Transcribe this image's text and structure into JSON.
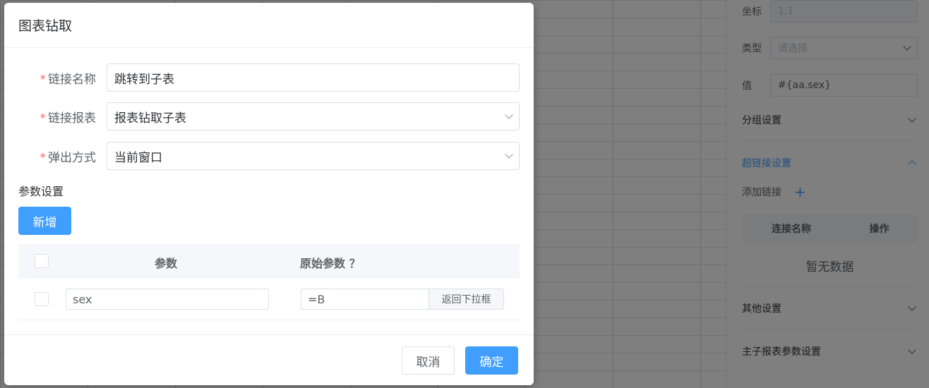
{
  "dialog": {
    "title": "图表钻取",
    "fields": [
      {
        "label": "链接名称",
        "value": "跳转到子表",
        "type": "input"
      },
      {
        "label": "链接报表",
        "value": "报表钻取子表",
        "type": "select"
      },
      {
        "label": "弹出方式",
        "value": "当前窗口",
        "type": "select"
      }
    ],
    "required_mark": "*",
    "params_section_title": "参数设置",
    "add_button": "新增",
    "table": {
      "headers": [
        "参数",
        "原始参数 ？"
      ],
      "rows": [
        {
          "param": "sex",
          "original": "=B",
          "append_label": "返回下拉框"
        }
      ]
    },
    "cancel_button": "取消",
    "confirm_button": "确定"
  },
  "right_panel": {
    "coord_label": "坐标",
    "coord_value": "1,1",
    "type_label": "类型",
    "type_placeholder": "请选择",
    "value_label": "值",
    "value_value": "#{aa.sex}",
    "group_settings": "分组设置",
    "hyperlink_settings": "超链接设置",
    "add_link_label": "添加链接",
    "add_link_icon": "+",
    "table_headers": [
      "连接名称",
      "操作"
    ],
    "empty_text": "暂无数据",
    "other_settings": "其他设置",
    "master_sub_settings": "主子报表参数设置"
  },
  "colors": {
    "primary": "#409eff",
    "required": "#f56c6c",
    "overlay": "rgba(0,0,0,0.5)"
  }
}
